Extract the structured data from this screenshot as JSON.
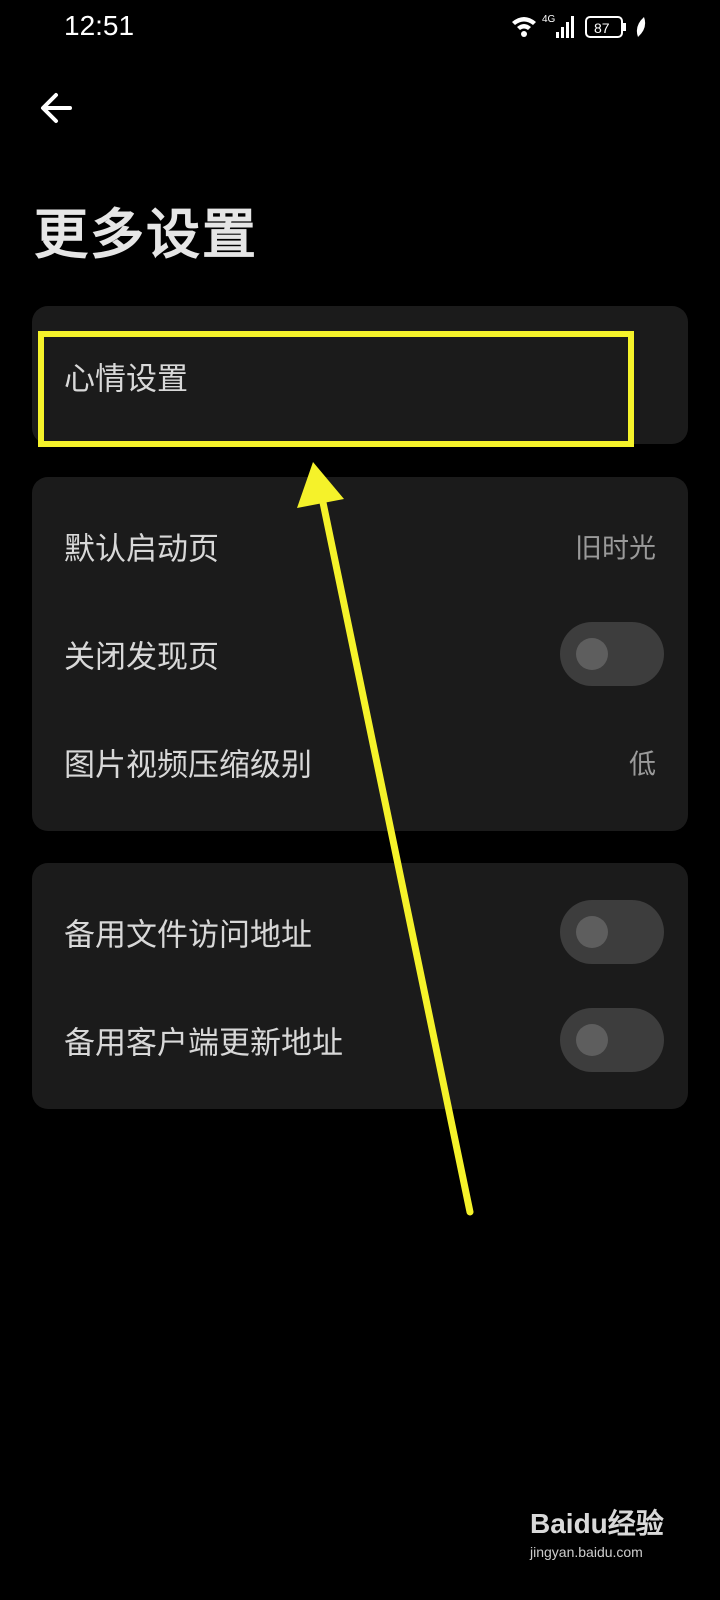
{
  "status_bar": {
    "time": "12:51",
    "network": "4G",
    "battery": "87",
    "icons": [
      "wifi-icon",
      "signal-icon",
      "battery-icon",
      "leaf-icon"
    ]
  },
  "header": {
    "back_icon": "back-arrow-icon",
    "title": "更多设置"
  },
  "groups": [
    {
      "items": [
        {
          "label": "心情设置"
        }
      ]
    },
    {
      "items": [
        {
          "label": "默认启动页",
          "value": "旧时光"
        },
        {
          "label": "关闭发现页",
          "toggle": false
        },
        {
          "label": "图片视频压缩级别",
          "value": "低"
        }
      ]
    },
    {
      "items": [
        {
          "label": "备用文件访问地址",
          "toggle": false
        },
        {
          "label": "备用客户端更新地址",
          "toggle": false
        }
      ]
    }
  ],
  "annotation": {
    "color": "#f5f22a"
  },
  "watermark": {
    "brand": "Baidu经验",
    "url": "jingyan.baidu.com"
  },
  "colors": {
    "background": "#000000",
    "card": "#1b1b1b",
    "toggle_track": "#3d3d3d",
    "toggle_knob": "#5e5e5e"
  }
}
